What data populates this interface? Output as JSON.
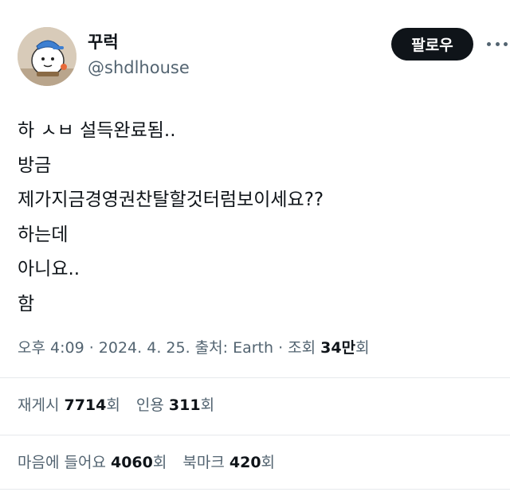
{
  "author": {
    "display_name": "꾸럭",
    "handle": "@shdlhouse",
    "avatar_icon": "cartoon-avatar-icon"
  },
  "actions": {
    "follow_label": "팔로우",
    "more_icon": "more-dots-icon"
  },
  "tweet": {
    "lines": [
      "하 ㅅㅂ 설득완료됨..",
      "방금",
      "제가지금경영권찬탈할것터럼보이세요??",
      "하는데",
      "아니요..",
      "함"
    ]
  },
  "meta": {
    "time": "오후 4:09",
    "sep1": " · ",
    "date": "2024. 4. 25.",
    "source_label": " 출처: ",
    "source": "Earth",
    "sep2": " · ",
    "views_label": "조회 ",
    "views_value": "34만",
    "views_unit": "회"
  },
  "stats": {
    "retweets": {
      "label": "재게시 ",
      "value": "7714",
      "unit": "회"
    },
    "quotes": {
      "label": "인용 ",
      "value": "311",
      "unit": "회"
    },
    "likes": {
      "label": "마음에 들어요 ",
      "value": "4060",
      "unit": "회"
    },
    "bookmarks": {
      "label": "북마크 ",
      "value": "420",
      "unit": "회"
    }
  },
  "colors": {
    "text": "#0f1419",
    "secondary": "#536471",
    "button_bg": "#0f1419",
    "divider": "#e6e9ec"
  }
}
